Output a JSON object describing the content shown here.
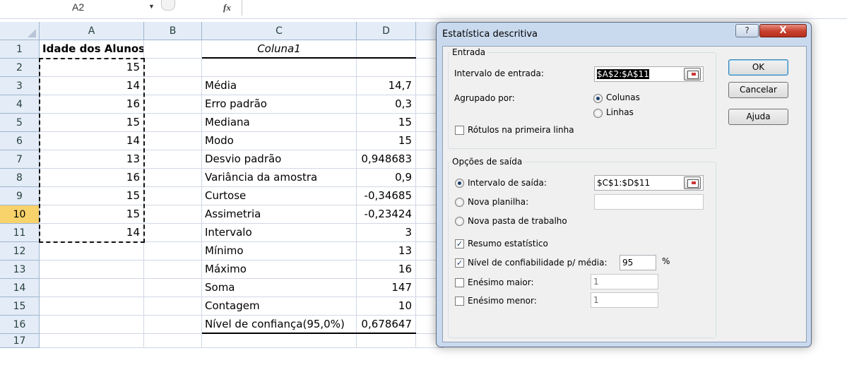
{
  "formula_bar": {
    "name_box": "A2",
    "fx_label": "fx"
  },
  "columns": [
    "A",
    "B",
    "C",
    "D"
  ],
  "rows": [
    "1",
    "2",
    "3",
    "4",
    "5",
    "6",
    "7",
    "8",
    "9",
    "10",
    "11",
    "12",
    "13",
    "14",
    "15",
    "16",
    "17"
  ],
  "column_a": {
    "header": "Idade dos Alunos",
    "values": [
      "15",
      "14",
      "16",
      "15",
      "14",
      "13",
      "16",
      "15",
      "15",
      "14"
    ]
  },
  "stats_table": {
    "header": "Coluna1",
    "labels": [
      "Média",
      "Erro padrão",
      "Mediana",
      "Modo",
      "Desvio padrão",
      "Variância da amostra",
      "Curtose",
      "Assimetria",
      "Intervalo",
      "Mínimo",
      "Máximo",
      "Soma",
      "Contagem",
      "Nível de confiança(95,0%)"
    ],
    "values": [
      "14,7",
      "0,3",
      "15",
      "15",
      "0,948683",
      "0,9",
      "-0,34685",
      "-0,23424",
      "3",
      "13",
      "16",
      "147",
      "10",
      "0,678647"
    ]
  },
  "dialog": {
    "title": "Estatística descritiva",
    "help_button": "?",
    "close_button": "X",
    "input_group": {
      "label": "Entrada",
      "range_label": "Intervalo de entrada:",
      "range_value": "$A$2:$A$11",
      "grouped_by_label": "Agrupado por:",
      "radio_columns": "Colunas",
      "radio_rows": "Linhas",
      "labels_first_row": "Rótulos na primeira linha"
    },
    "output_group": {
      "label": "Opções de saída",
      "output_range_label": "Intervalo de saída:",
      "output_range_value": "$C$1:$D$11",
      "new_sheet_label": "Nova planilha:",
      "new_workbook_label": "Nova pasta de trabalho",
      "summary_label": "Resumo estatístico",
      "confidence_label": "Nível de confiabilidade p/ média:",
      "confidence_value": "95",
      "percent": "%",
      "kth_largest_label": "Enésimo maior:",
      "kth_largest_value": "1",
      "kth_smallest_label": "Enésimo menor:",
      "kth_smallest_value": "1"
    },
    "buttons": {
      "ok": "OK",
      "cancel": "Cancelar",
      "help": "Ajuda"
    }
  }
}
